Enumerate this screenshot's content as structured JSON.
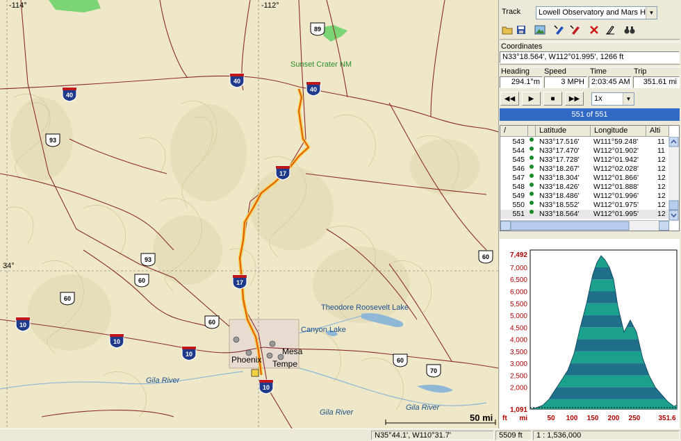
{
  "map": {
    "longitude_labels": [
      "-114°",
      "-112°"
    ],
    "latitude_labels": [
      "34°"
    ],
    "place_labels": [
      "Sunset Crater NM",
      "Theodore Roosevelt Lake",
      "Canyon Lake",
      "Gila River",
      "Gila River",
      "Gila River",
      "Phoenix",
      "Mesa",
      "Tempe"
    ],
    "interstate_shields": [
      "40",
      "40",
      "40",
      "17",
      "17",
      "10",
      "10",
      "10",
      "10"
    ],
    "us_shields": [
      "89",
      "93",
      "93",
      "60",
      "60",
      "60",
      "60",
      "60",
      "70"
    ],
    "scale_label": "50 mi",
    "colors": {
      "background": "#efe8c8",
      "track": "#e65c00",
      "track_halo": "#f5d040",
      "road": "#8a2b2b",
      "water": "#8fb7d6",
      "park": "#5fcf5f"
    }
  },
  "panel": {
    "track_label": "Track",
    "track_name": "Lowell Observatory and Mars Hill I",
    "toolbar_icons": [
      "open-folder-icon",
      "save-icon",
      "image-icon",
      "pen-blue-icon",
      "pen-red-icon",
      "delete-icon",
      "edit-icon",
      "binoculars-icon"
    ],
    "coordinates_label": "Coordinates",
    "coordinates_value": "N33°18.564', W112°01.995', 1266 ft",
    "heading_label": "Heading",
    "speed_label": "Speed",
    "time_label": "Time",
    "trip_label": "Trip",
    "heading_value": "294.1°m",
    "speed_value": "3 MPH",
    "time_value": "2:03:45 AM",
    "trip_value": "351.61 mi",
    "speed_select": "1x",
    "progress_text": "551 of 551",
    "progress_fraction": 1.0
  },
  "table": {
    "headers": [
      "/",
      "",
      "Latitude",
      "Longitude",
      "Alti"
    ],
    "rows": [
      {
        "n": "543",
        "lat": "N33°17.516'",
        "lon": "W111°59.248'",
        "alt": "11"
      },
      {
        "n": "544",
        "lat": "N33°17.470'",
        "lon": "W112°01.902'",
        "alt": "11"
      },
      {
        "n": "545",
        "lat": "N33°17.728'",
        "lon": "W112°01.942'",
        "alt": "12"
      },
      {
        "n": "546",
        "lat": "N33°18.267'",
        "lon": "W112°02.028'",
        "alt": "12"
      },
      {
        "n": "547",
        "lat": "N33°18.304'",
        "lon": "W112°01.866'",
        "alt": "12"
      },
      {
        "n": "548",
        "lat": "N33°18.426'",
        "lon": "W112°01.888'",
        "alt": "12"
      },
      {
        "n": "549",
        "lat": "N33°18.486'",
        "lon": "W112°01.996'",
        "alt": "12"
      },
      {
        "n": "550",
        "lat": "N33°18.552'",
        "lon": "W112°01.975'",
        "alt": "12"
      },
      {
        "n": "551",
        "lat": "N33°18.564'",
        "lon": "W112°01.995'",
        "alt": "12"
      }
    ]
  },
  "profile": {
    "y_ticks": [
      "7,492",
      "7,000",
      "6,500",
      "6,000",
      "5,500",
      "5,000",
      "4,500",
      "4,000",
      "3,500",
      "3,000",
      "2,500",
      "2,000",
      "1,091"
    ],
    "y_unit": "ft",
    "x_ticks": [
      "50",
      "100",
      "150",
      "200",
      "250",
      "351.6"
    ],
    "x_unit": "mi",
    "colors": {
      "band_a": "#1f6f8b",
      "band_b": "#1aa08c",
      "axis_text": "#b00000"
    }
  },
  "status": {
    "cursor_position": "N35°44.1', W110°31.7'",
    "cursor_elevation": "5509 ft",
    "scale": "1 : 1,536,000"
  },
  "chart_data": {
    "type": "area",
    "x": [
      0,
      15,
      30,
      45,
      60,
      75,
      90,
      105,
      120,
      135,
      150,
      160,
      170,
      180,
      190,
      200,
      210,
      225,
      240,
      255,
      270,
      285,
      300,
      315,
      330,
      345,
      351.6
    ],
    "y": [
      1091,
      1150,
      1250,
      1500,
      1900,
      2300,
      2700,
      3400,
      4500,
      5500,
      6700,
      7200,
      7492,
      7300,
      7000,
      6500,
      5400,
      4300,
      4800,
      4300,
      3200,
      2500,
      2000,
      1700,
      1400,
      1200,
      1266
    ],
    "xlabel": "mi",
    "ylabel": "ft",
    "xlim": [
      0,
      351.6
    ],
    "ylim": [
      1091,
      7492
    ],
    "x_ticks": [
      "50",
      "100",
      "150",
      "200",
      "250",
      "351.6"
    ],
    "y_ticks": [
      "7,492",
      "7,000",
      "6,500",
      "6,000",
      "5,500",
      "5,000",
      "4,500",
      "4,000",
      "3,500",
      "3,000",
      "2,500",
      "2,000",
      "1,091"
    ]
  }
}
